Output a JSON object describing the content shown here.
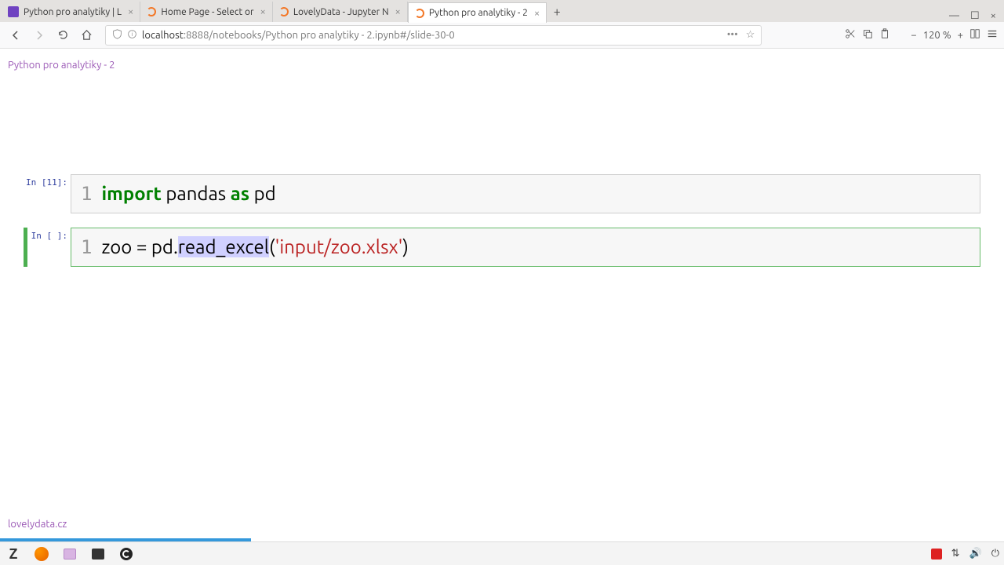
{
  "tabs": [
    {
      "label": "Python pro analytiky | L",
      "favicon": "fav-purple"
    },
    {
      "label": "Home Page - Select or",
      "favicon": "fav-orange"
    },
    {
      "label": "LovelyData - Jupyter N",
      "favicon": "fav-orange"
    },
    {
      "label": "Python pro analytiky - 2",
      "favicon": "fav-orange",
      "active": true
    }
  ],
  "url": {
    "host": "localhost",
    "path": ":8888/notebooks/Python pro analytiky - 2.ipynb#/slide-30-0"
  },
  "zoom": "120 %",
  "breadcrumb": "Python pro analytiky - 2",
  "footer": "lovelydata.cz",
  "cells": [
    {
      "prompt": "In [11]:",
      "active": false,
      "lineno": "1",
      "code": [
        {
          "t": "import",
          "c": "tok-kw"
        },
        {
          "t": " pandas "
        },
        {
          "t": "as",
          "c": "tok-kw"
        },
        {
          "t": " pd"
        }
      ]
    },
    {
      "prompt": "In [ ]:",
      "active": true,
      "lineno": "1",
      "code": [
        {
          "t": "zoo = pd."
        },
        {
          "t": "read_excel",
          "c": "sel"
        },
        {
          "t": "("
        },
        {
          "t": "'input/zoo.xlsx'",
          "c": "tok-str"
        },
        {
          "t": ")"
        }
      ]
    }
  ]
}
